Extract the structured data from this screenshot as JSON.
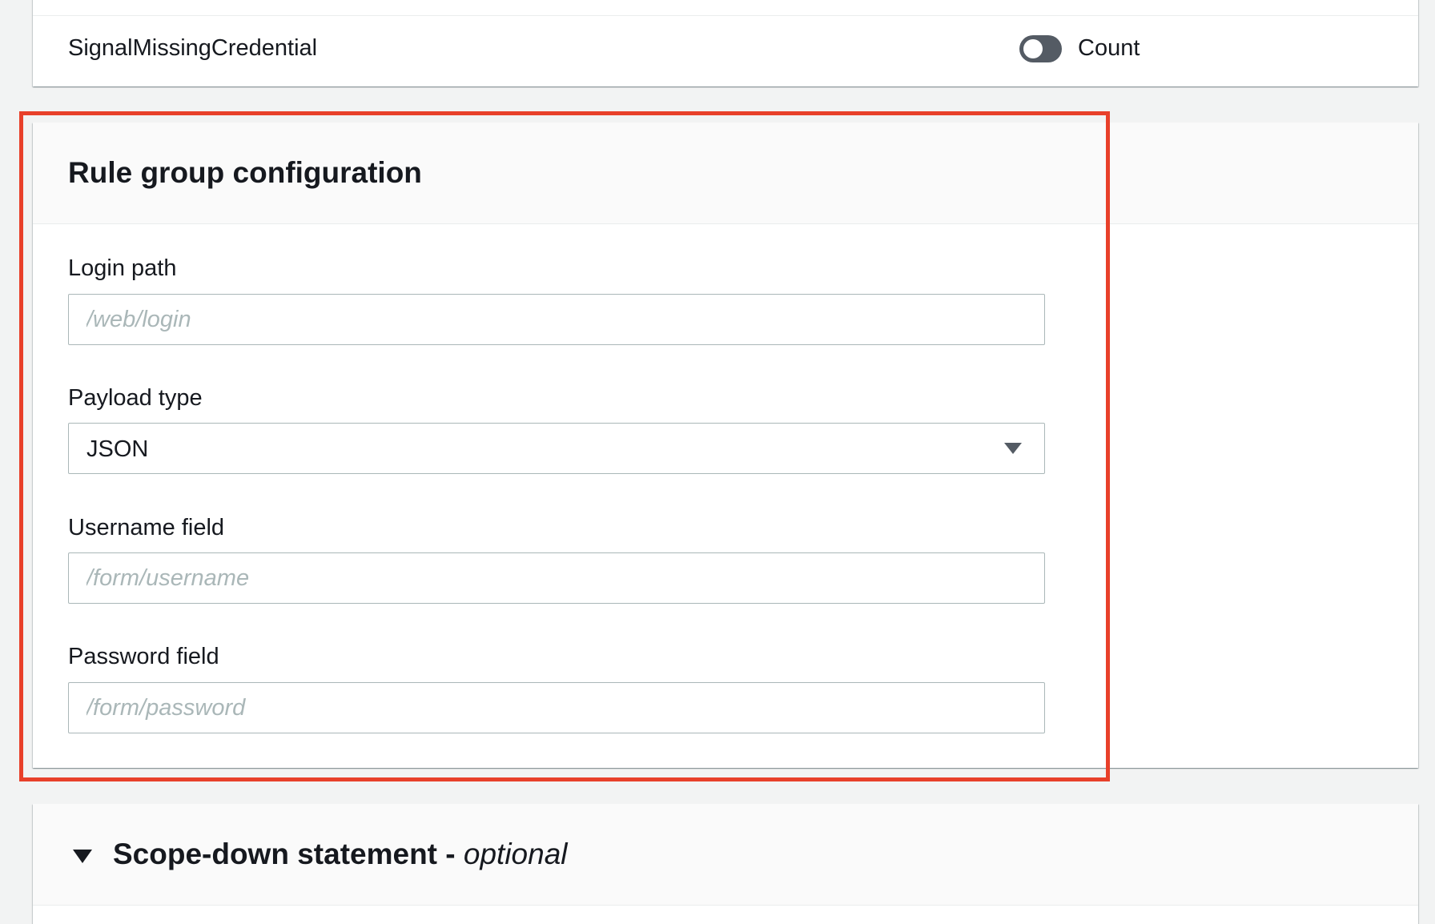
{
  "rule_row": {
    "name": "SignalMissingCredential",
    "action_toggle_label": "Count",
    "toggle_on": false
  },
  "config": {
    "title": "Rule group configuration",
    "login_path": {
      "label": "Login path",
      "value": "",
      "placeholder": "/web/login"
    },
    "payload_type": {
      "label": "Payload type",
      "selected": "JSON"
    },
    "username_field": {
      "label": "Username field",
      "value": "",
      "placeholder": "/form/username"
    },
    "password_field": {
      "label": "Password field",
      "value": "",
      "placeholder": "/form/password"
    }
  },
  "scope_down": {
    "title": "Scope-down statement",
    "separator": " - ",
    "qualifier": "optional",
    "expanded": true
  },
  "colors": {
    "highlight": "#e8402a",
    "toggle_off": "#545b64",
    "placeholder": "#aab7b8"
  },
  "icons": [
    "toggle-switch",
    "caret-down-icon",
    "triangle-down-icon"
  ]
}
